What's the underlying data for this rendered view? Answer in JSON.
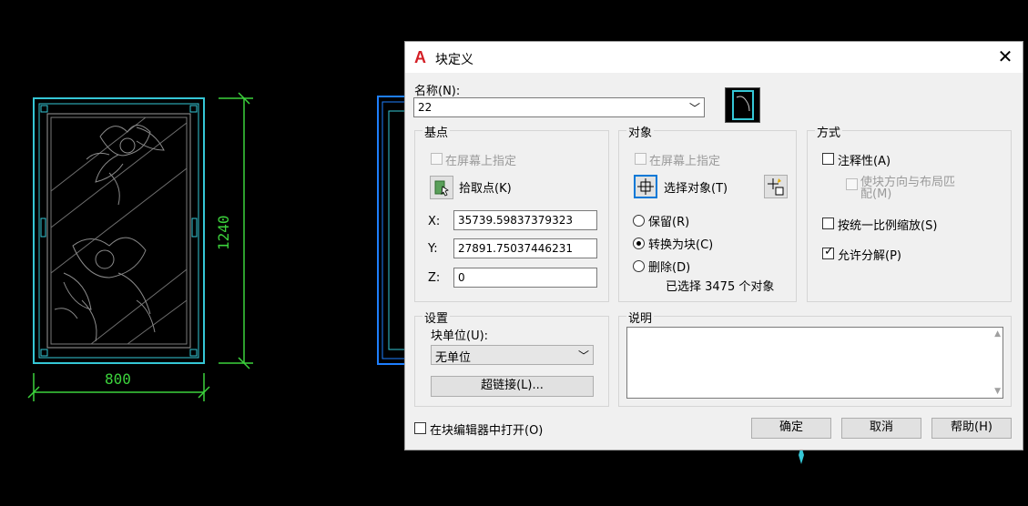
{
  "cad": {
    "dim_height": "1240",
    "dim_width": "800"
  },
  "dialog": {
    "title": "块定义",
    "close_glyph": "✕",
    "name_label": "名称(N):",
    "name_value": "22",
    "basepoint": {
      "title": "基点",
      "onscreen_label": "在屏幕上指定",
      "pick_label": "拾取点(K)",
      "x_label": "X:",
      "x_value": "35739.59837379323",
      "y_label": "Y:",
      "y_value": "27891.75037446231",
      "z_label": "Z:",
      "z_value": "0"
    },
    "objects": {
      "title": "对象",
      "onscreen_label": "在屏幕上指定",
      "select_label": "选择对象(T)",
      "retain_label": "保留(R)",
      "convert_label": "转换为块(C)",
      "delete_label": "删除(D)",
      "selected_text": "已选择 3475 个对象"
    },
    "behavior": {
      "title": "方式",
      "annotative_label": "注释性(A)",
      "match_orient_label": "使块方向与布局匹配(M)",
      "scale_uniform_label": "按统一比例缩放(S)",
      "allow_explode_label": "允许分解(P)"
    },
    "settings": {
      "title": "设置",
      "unit_label": "块单位(U):",
      "unit_value": "无单位",
      "hyperlink_label": "超链接(L)..."
    },
    "description": {
      "title": "说明",
      "value": ""
    },
    "open_in_editor_label": "在块编辑器中打开(O)",
    "ok_label": "确定",
    "cancel_label": "取消",
    "help_label": "帮助(H)",
    "states": {
      "convert_selected": true,
      "allow_explode_checked": true,
      "annotative_checked": false,
      "scale_uniform_checked": false,
      "open_in_editor_checked": false
    }
  },
  "colors": {
    "background": "#000000",
    "frame_cyan": "#35c7d6",
    "dimension_green": "#3cd23c",
    "highlight_blue": "#1e7fff",
    "accent_focus": "#0078d7",
    "autocad_red": "#d41f26"
  }
}
